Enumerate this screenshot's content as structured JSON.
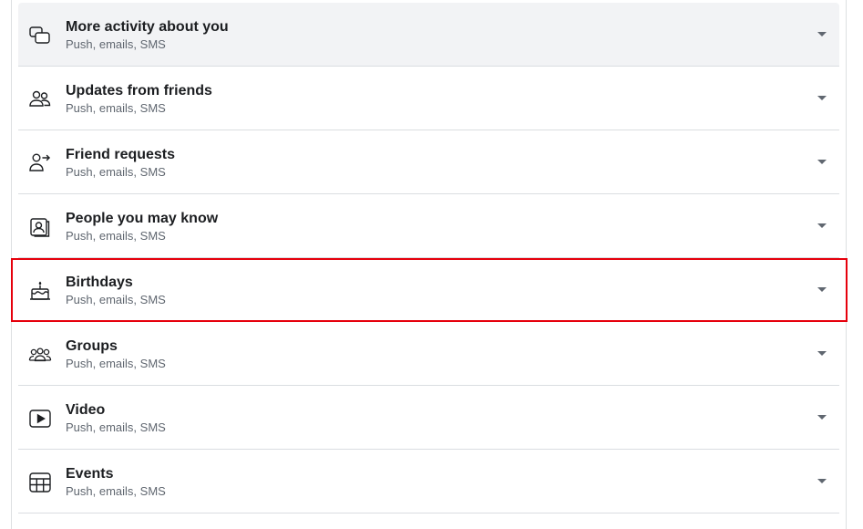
{
  "settings": {
    "items": [
      {
        "title": "More activity about you",
        "subtitle": "Push, emails, SMS",
        "icon": "chat-bubbles-icon"
      },
      {
        "title": "Updates from friends",
        "subtitle": "Push, emails, SMS",
        "icon": "friends-icon"
      },
      {
        "title": "Friend requests",
        "subtitle": "Push, emails, SMS",
        "icon": "friend-request-icon"
      },
      {
        "title": "People you may know",
        "subtitle": "Push, emails, SMS",
        "icon": "people-cards-icon"
      },
      {
        "title": "Birthdays",
        "subtitle": "Push, emails, SMS",
        "icon": "birthday-cake-icon"
      },
      {
        "title": "Groups",
        "subtitle": "Push, emails, SMS",
        "icon": "groups-icon"
      },
      {
        "title": "Video",
        "subtitle": "Push, emails, SMS",
        "icon": "video-play-icon"
      },
      {
        "title": "Events",
        "subtitle": "Push, emails, SMS",
        "icon": "calendar-icon"
      }
    ]
  },
  "colors": {
    "highlight_border": "#e6000c",
    "active_row_bg": "#f2f3f5",
    "title_text": "#1c1e21",
    "subtitle_text": "#606770"
  }
}
